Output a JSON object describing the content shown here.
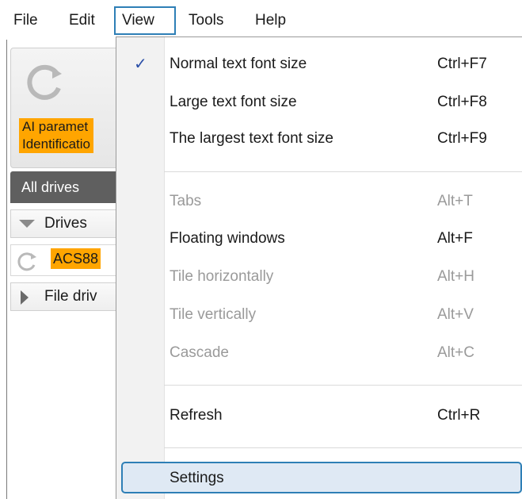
{
  "menubar": {
    "items": [
      "File",
      "Edit",
      "View",
      "Tools",
      "Help"
    ],
    "active": "View"
  },
  "left_panel": {
    "ribbon_label": "AI paramet\nIdentificatio",
    "tab_label": "All drives",
    "drives_group": "Drives",
    "drive_name": "ACS88",
    "file_drives": "File driv"
  },
  "view_menu": {
    "items": [
      {
        "label": "Normal text font size",
        "shortcut": "Ctrl+F7",
        "checked": true,
        "enabled": true
      },
      {
        "label": "Large text font size",
        "shortcut": "Ctrl+F8",
        "checked": false,
        "enabled": true
      },
      {
        "label": "The largest text font size",
        "shortcut": "Ctrl+F9",
        "checked": false,
        "enabled": true
      },
      {
        "label": "Tabs",
        "shortcut": "Alt+T",
        "checked": false,
        "enabled": false
      },
      {
        "label": "Floating windows",
        "shortcut": "Alt+F",
        "checked": false,
        "enabled": true
      },
      {
        "label": "Tile horizontally",
        "shortcut": "Alt+H",
        "checked": false,
        "enabled": false
      },
      {
        "label": "Tile vertically",
        "shortcut": "Alt+V",
        "checked": false,
        "enabled": false
      },
      {
        "label": "Cascade",
        "shortcut": "Alt+C",
        "checked": false,
        "enabled": false
      },
      {
        "label": "Refresh",
        "shortcut": "Ctrl+R",
        "checked": false,
        "enabled": true
      },
      {
        "label": "Settings",
        "shortcut": "",
        "checked": false,
        "enabled": true,
        "hovered": true
      }
    ],
    "check_glyph": "✓"
  },
  "colors": {
    "highlight_orange": "#ffa500",
    "accent_blue": "#2e7fb6",
    "check_blue": "#2b4fa8",
    "disabled_text": "#9a9a9a"
  }
}
